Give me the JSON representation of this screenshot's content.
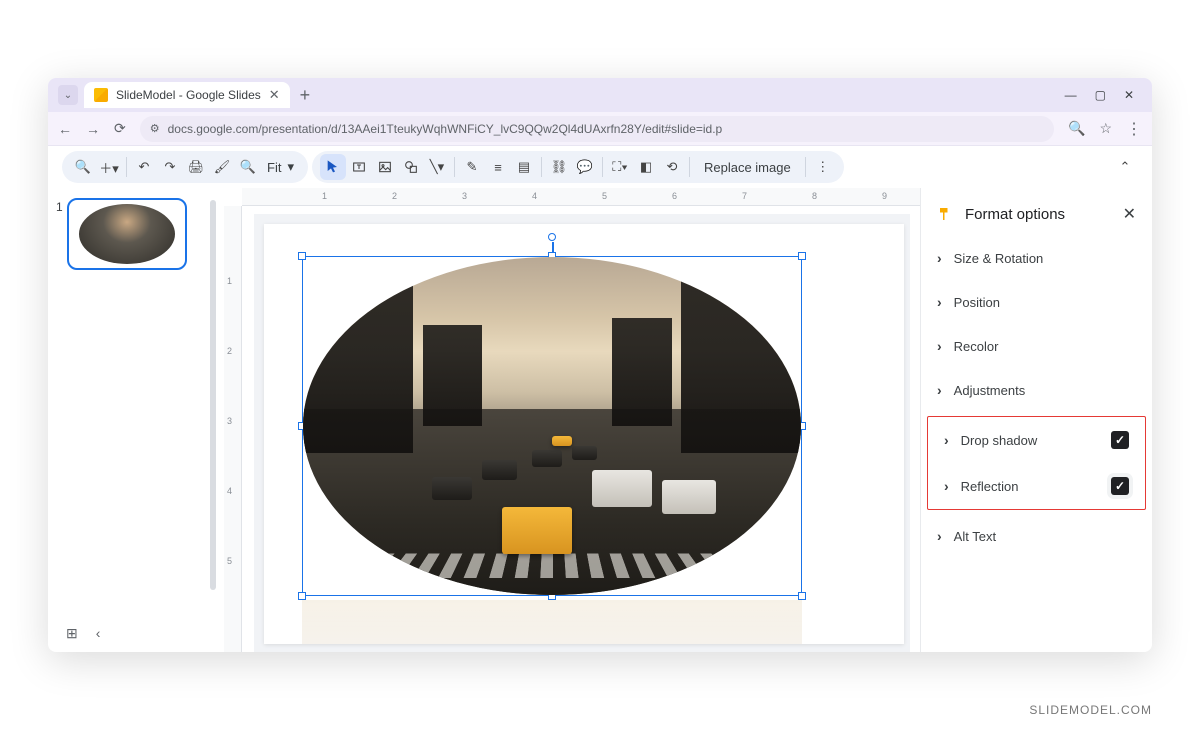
{
  "browser": {
    "tab_title": "SlideModel - Google Slides",
    "url": "docs.google.com/presentation/d/13AAei1TteukyWqhWNFiCY_lvC9QQw2Ql4dUAxrfn28Y/edit#slide=id.p"
  },
  "toolbar": {
    "fit_label": "Fit",
    "replace_image": "Replace image"
  },
  "ruler_h": [
    "1",
    "2",
    "3",
    "4",
    "5",
    "6",
    "7",
    "8",
    "9"
  ],
  "ruler_v": [
    "1",
    "2",
    "3",
    "4",
    "5"
  ],
  "filmstrip": {
    "slide_number": "1"
  },
  "panel": {
    "title": "Format options",
    "rows": {
      "size_rotation": "Size & Rotation",
      "position": "Position",
      "recolor": "Recolor",
      "adjustments": "Adjustments",
      "drop_shadow": "Drop shadow",
      "reflection": "Reflection",
      "alt_text": "Alt Text"
    }
  },
  "watermark": "SLIDEMODEL.COM"
}
